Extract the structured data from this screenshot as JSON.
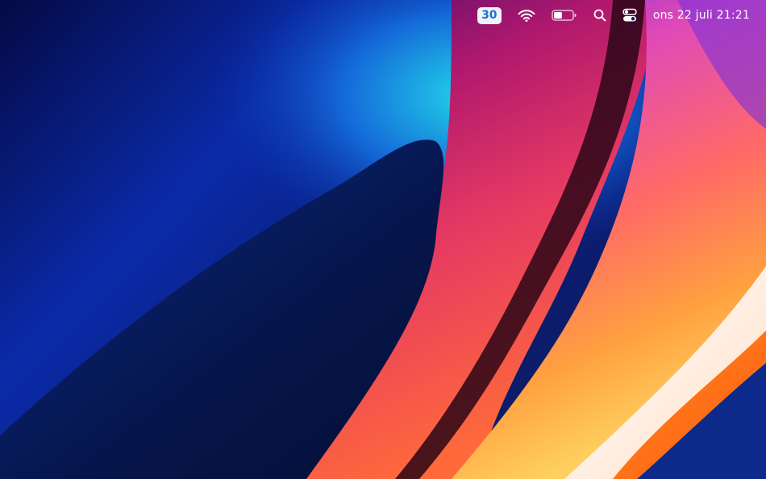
{
  "menubar": {
    "calendar_badge": "30",
    "clock": "ons 22 juli 21:21",
    "icons": [
      "calendar-badge",
      "wifi-icon",
      "battery-icon",
      "search-icon",
      "control-center-icon"
    ],
    "battery_level": 0.45
  },
  "colors": {
    "badge_bg": "#eef3f8",
    "badge_text": "#1f6fd6",
    "menubar_text": "#ffffff"
  }
}
